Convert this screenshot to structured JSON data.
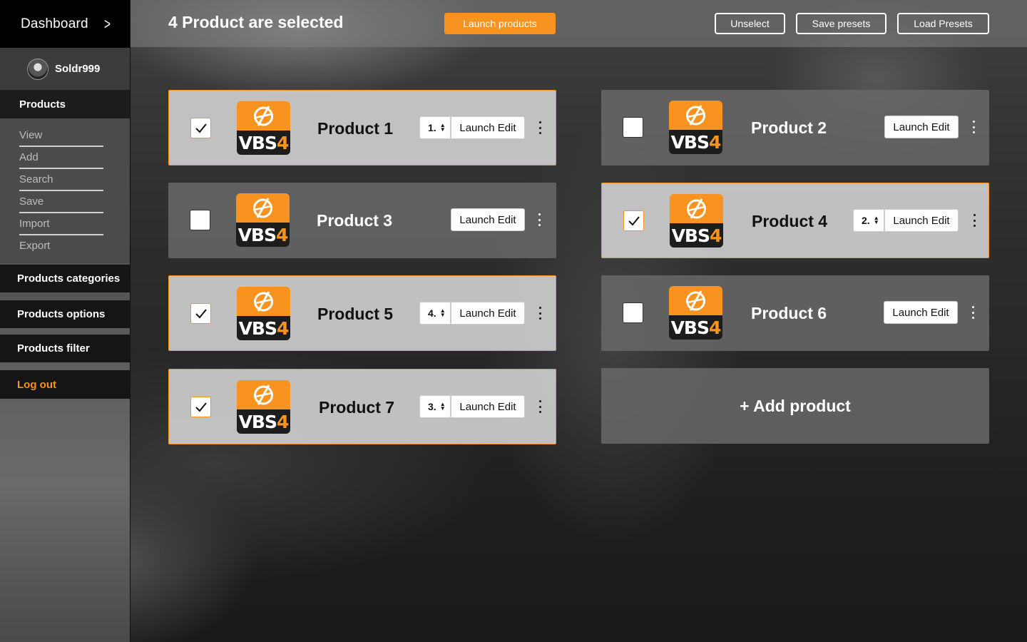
{
  "sidebar": {
    "dashboard_label": "Dashboard",
    "username": "Soldr999",
    "products_label": "Products",
    "submenu": [
      "View",
      "Add",
      "Search",
      "Save",
      "Import",
      "Export"
    ],
    "categories_label": "Products categories",
    "options_label": "Products options",
    "filter_label": "Products filter",
    "logout_label": "Log out"
  },
  "topbar": {
    "title": "4 Product are selected",
    "launch_label": "Launch products",
    "unselect_label": "Unselect",
    "save_presets_label": "Save presets",
    "load_presets_label": "Load Presets"
  },
  "logo": {
    "brand": "VBS",
    "version": "4"
  },
  "products": [
    {
      "name": "Product 1",
      "selected": true,
      "order": "1.",
      "launch_label": "Launch Edit"
    },
    {
      "name": "Product 2",
      "selected": false,
      "order": "",
      "launch_label": "Launch Edit"
    },
    {
      "name": "Product 3",
      "selected": false,
      "order": "",
      "launch_label": "Launch Edit"
    },
    {
      "name": "Product 4",
      "selected": true,
      "order": "2.",
      "launch_label": "Launch Edit"
    },
    {
      "name": "Product 5",
      "selected": true,
      "order": "4.",
      "launch_label": "Launch Edit"
    },
    {
      "name": "Product 6",
      "selected": false,
      "order": "",
      "launch_label": "Launch Edit"
    },
    {
      "name": "Product 7",
      "selected": true,
      "order": "3.",
      "launch_label": "Launch Edit"
    }
  ],
  "add_product_label": "+ Add product",
  "colors": {
    "accent": "#f7931e",
    "dark": "#000000"
  }
}
